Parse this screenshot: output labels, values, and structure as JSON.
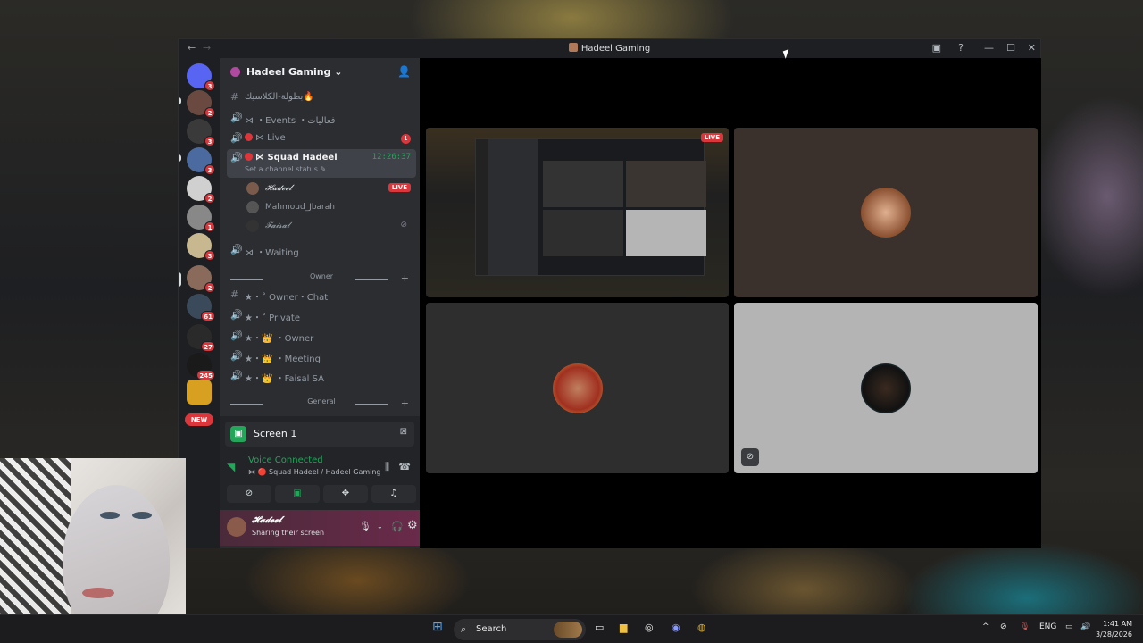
{
  "window": {
    "title": "Hadeel Gaming",
    "back_glyph": "←",
    "forward_glyph": "→",
    "controls": [
      "—",
      "☐",
      "✕"
    ],
    "icons": [
      "inbox-icon",
      "help-icon"
    ]
  },
  "server_rail": {
    "badges": [
      "3",
      "2",
      "3",
      "3",
      "2",
      "1",
      "3",
      "2",
      "2",
      "61",
      "27",
      "245",
      "NEW"
    ]
  },
  "server": {
    "name": "Hadeel Gaming",
    "chevron": "⌄"
  },
  "channels": [
    {
      "icon": "#",
      "label": "بطولة-الكلاسيك🔥"
    },
    {
      "icon": "🔊",
      "label": "⋈ ・Events ・فعاليات"
    },
    {
      "icon": "🔊",
      "label": "⋈ Live",
      "count": "1",
      "dot": true
    },
    {
      "icon": "🔊",
      "label": "⋈ Squad Hadeel",
      "time": "12:26:37",
      "status": "Set a channel status ✎",
      "dot": true,
      "selected": true
    },
    {
      "icon": "🔊",
      "label": "⋈ ・Waiting"
    },
    {
      "icon": "#",
      "label": "★・˚ Owner・Chat"
    },
    {
      "icon": "🔊",
      "label": "★・˚ Private"
    },
    {
      "icon": "🔊",
      "label": "★・👑 ・Owner"
    },
    {
      "icon": "🔊",
      "label": "★・👑 ・Meeting"
    },
    {
      "icon": "🔊",
      "label": "★・👑 ・Faisal SA"
    }
  ],
  "voice_users": [
    {
      "name": "𝓗𝓪𝓭𝓮𝓮𝓵",
      "live": "LIVE"
    },
    {
      "name": "Mahmoud_Jbarah"
    },
    {
      "name": "𝓕𝓪𝓲𝓼𝓪𝓵",
      "muted": true
    }
  ],
  "categories": [
    {
      "label": "Owner"
    },
    {
      "label": "General"
    }
  ],
  "rtc": {
    "screen_label": "Screen 1",
    "voice_status": "Voice Connected",
    "voice_channel": "⋈ 🔴 Squad Hadeel / Hadeel Gaming"
  },
  "user_panel": {
    "name": "𝓗𝓪𝓭𝓮𝓮𝓵",
    "status": "Sharing their screen"
  },
  "stage": {
    "live_badge": "LIVE"
  },
  "taskbar": {
    "search_label": "Search",
    "lang": "ENG",
    "time": "1:41 AM",
    "date": "3/28/2026"
  },
  "colors": {
    "accent_green": "#23a55a",
    "alert_red": "#da373c",
    "panel": "#2b2d31",
    "rail": "#1e1f22"
  }
}
